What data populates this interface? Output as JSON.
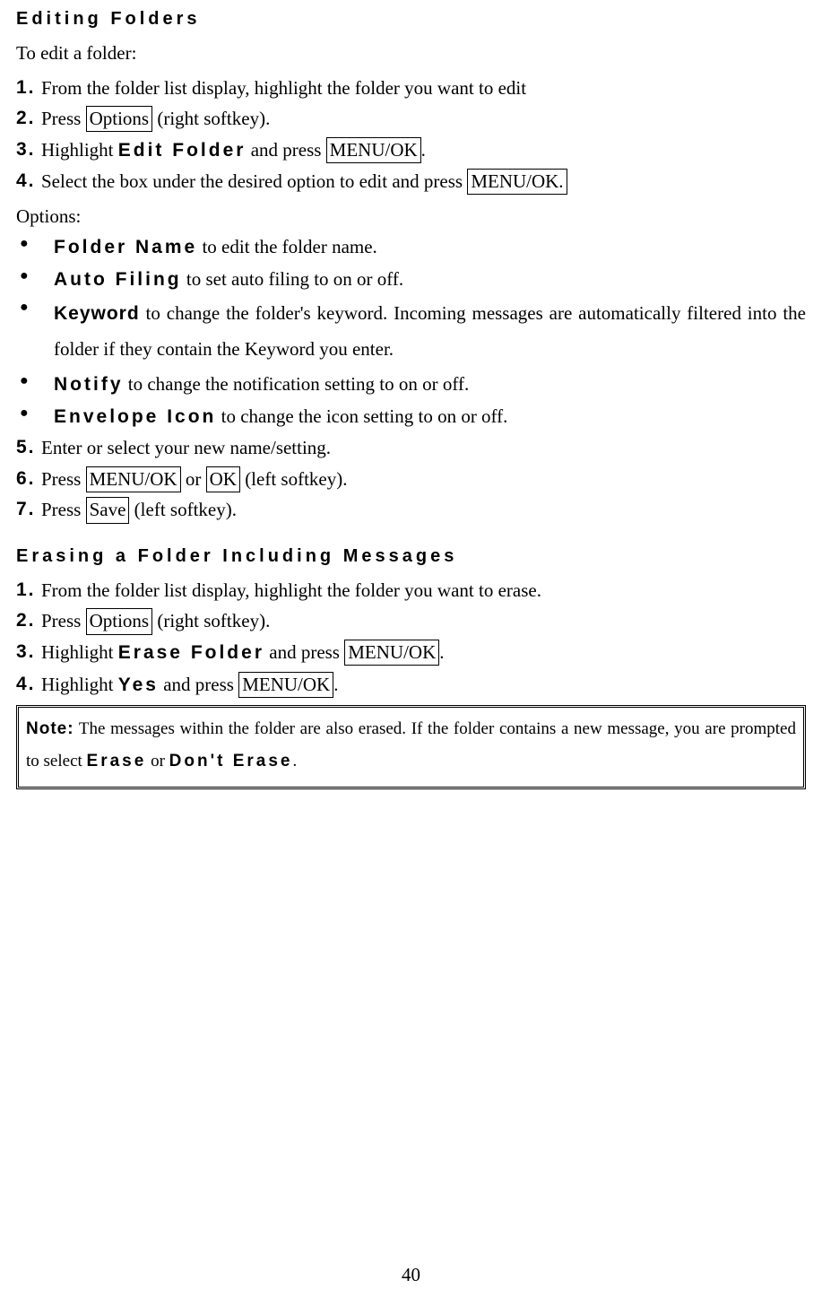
{
  "sec1": {
    "title": "Editing Folders",
    "intro": "To edit a folder:",
    "steps": {
      "n1": "1.",
      "t1a": "From the folder list display, highlight the folder you want to edit",
      "n2": "2.",
      "t2a": "Press ",
      "k2": "Options",
      "t2b": " (right softkey).",
      "n3": "3.",
      "t3a": "Highlight ",
      "m3": "Edit Folder",
      "t3b": " and press ",
      "k3": "MENU/OK",
      "t3c": ".",
      "n4": "4.",
      "t4a": "Select the box under the desired option to edit and press ",
      "k4": "MENU/OK.",
      "optionsLabel": "Options:",
      "b1m": "Folder Name",
      "b1t": " to edit the folder name.",
      "b2m": "Auto Filing",
      "b2t": " to set auto filing to on or off.",
      "b3m": "Keyword",
      "b3t": " to change the folder's keyword. Incoming messages are automatically filtered into the folder if they contain the Keyword you enter.",
      "b4m": "Notify",
      "b4t": " to change the notification setting to on or off.",
      "b5m": "Envelope Icon",
      "b5t": " to change the icon setting to on or off.",
      "n5": "5.",
      "t5a": "Enter or select your new name/setting.",
      "n6": "6.",
      "t6a": "Press ",
      "k6a": "MENU/OK",
      "t6b": " or ",
      "k6b": "OK",
      "t6c": " (left softkey).",
      "n7": "7.",
      "t7a": "Press ",
      "k7": "Save",
      "t7b": " (left softkey)."
    }
  },
  "sec2": {
    "title": "Erasing a Folder Including Messages",
    "steps": {
      "n1": "1.",
      "t1a": "From the folder list display, highlight the folder you want to erase.",
      "n2": "2.",
      "t2a": "Press ",
      "k2": "Options",
      "t2b": " (right softkey).",
      "n3": "3.",
      "t3a": "Highlight ",
      "m3": "Erase Folder",
      "t3b": " and press ",
      "k3": "MENU/OK",
      "t3c": ".",
      "n4": "4.",
      "t4a": "Highlight ",
      "m4": "Yes",
      "t4b": " and press ",
      "k4": "MENU/OK",
      "t4c": "."
    },
    "note": {
      "lead": "Note:",
      "t1": " The messages within the folder are also erased. If the folder contains a new message, you are prompted to select ",
      "m1": "Erase",
      "t2": " or ",
      "m2": "Don't Erase",
      "t3": "."
    }
  },
  "pageNumber": "40"
}
